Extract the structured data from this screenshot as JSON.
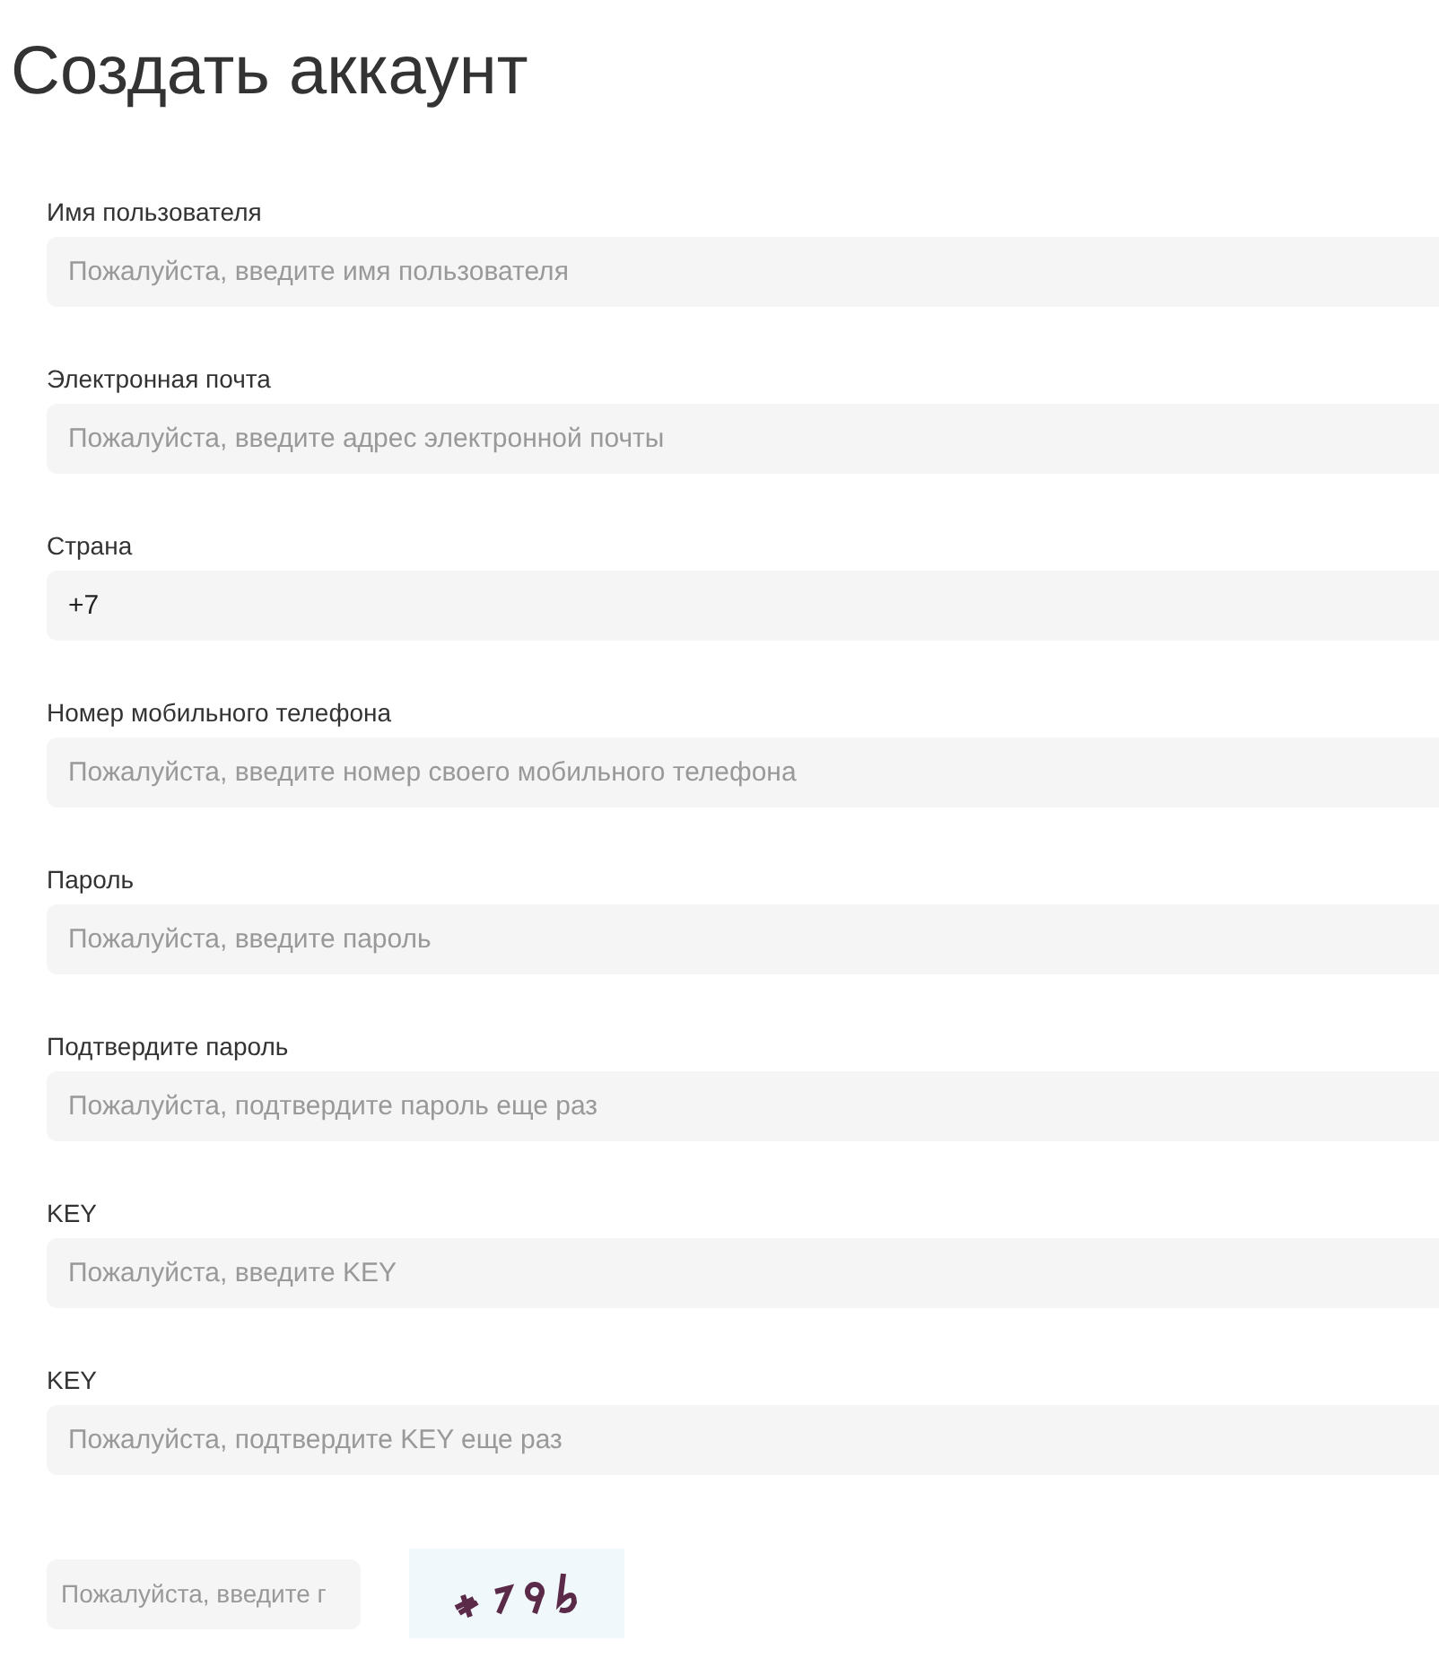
{
  "title": "Создать аккаунт",
  "fields": [
    {
      "label": "Имя пользователя",
      "placeholder": "Пожалуйста, введите имя пользователя"
    },
    {
      "label": "Электронная почта",
      "placeholder": "Пожалуйста, введите адрес электронной почты"
    },
    {
      "label": "Страна",
      "value": "+7"
    },
    {
      "label": "Номер мобильного телефона",
      "placeholder": "Пожалуйста, введите номер своего мобильного телефона"
    },
    {
      "label": "Пароль",
      "placeholder": "Пожалуйста, введите пароль"
    },
    {
      "label": "Подтвердите пароль",
      "placeholder": "Пожалуйста, подтвердите пароль еще раз"
    },
    {
      "label": "KEY",
      "placeholder": "Пожалуйста, введите KEY"
    },
    {
      "label": "KEY",
      "placeholder": "Пожалуйста, подтвердите KEY еще раз"
    }
  ],
  "captcha": {
    "placeholder": "Пожалуйста, введите г"
  }
}
